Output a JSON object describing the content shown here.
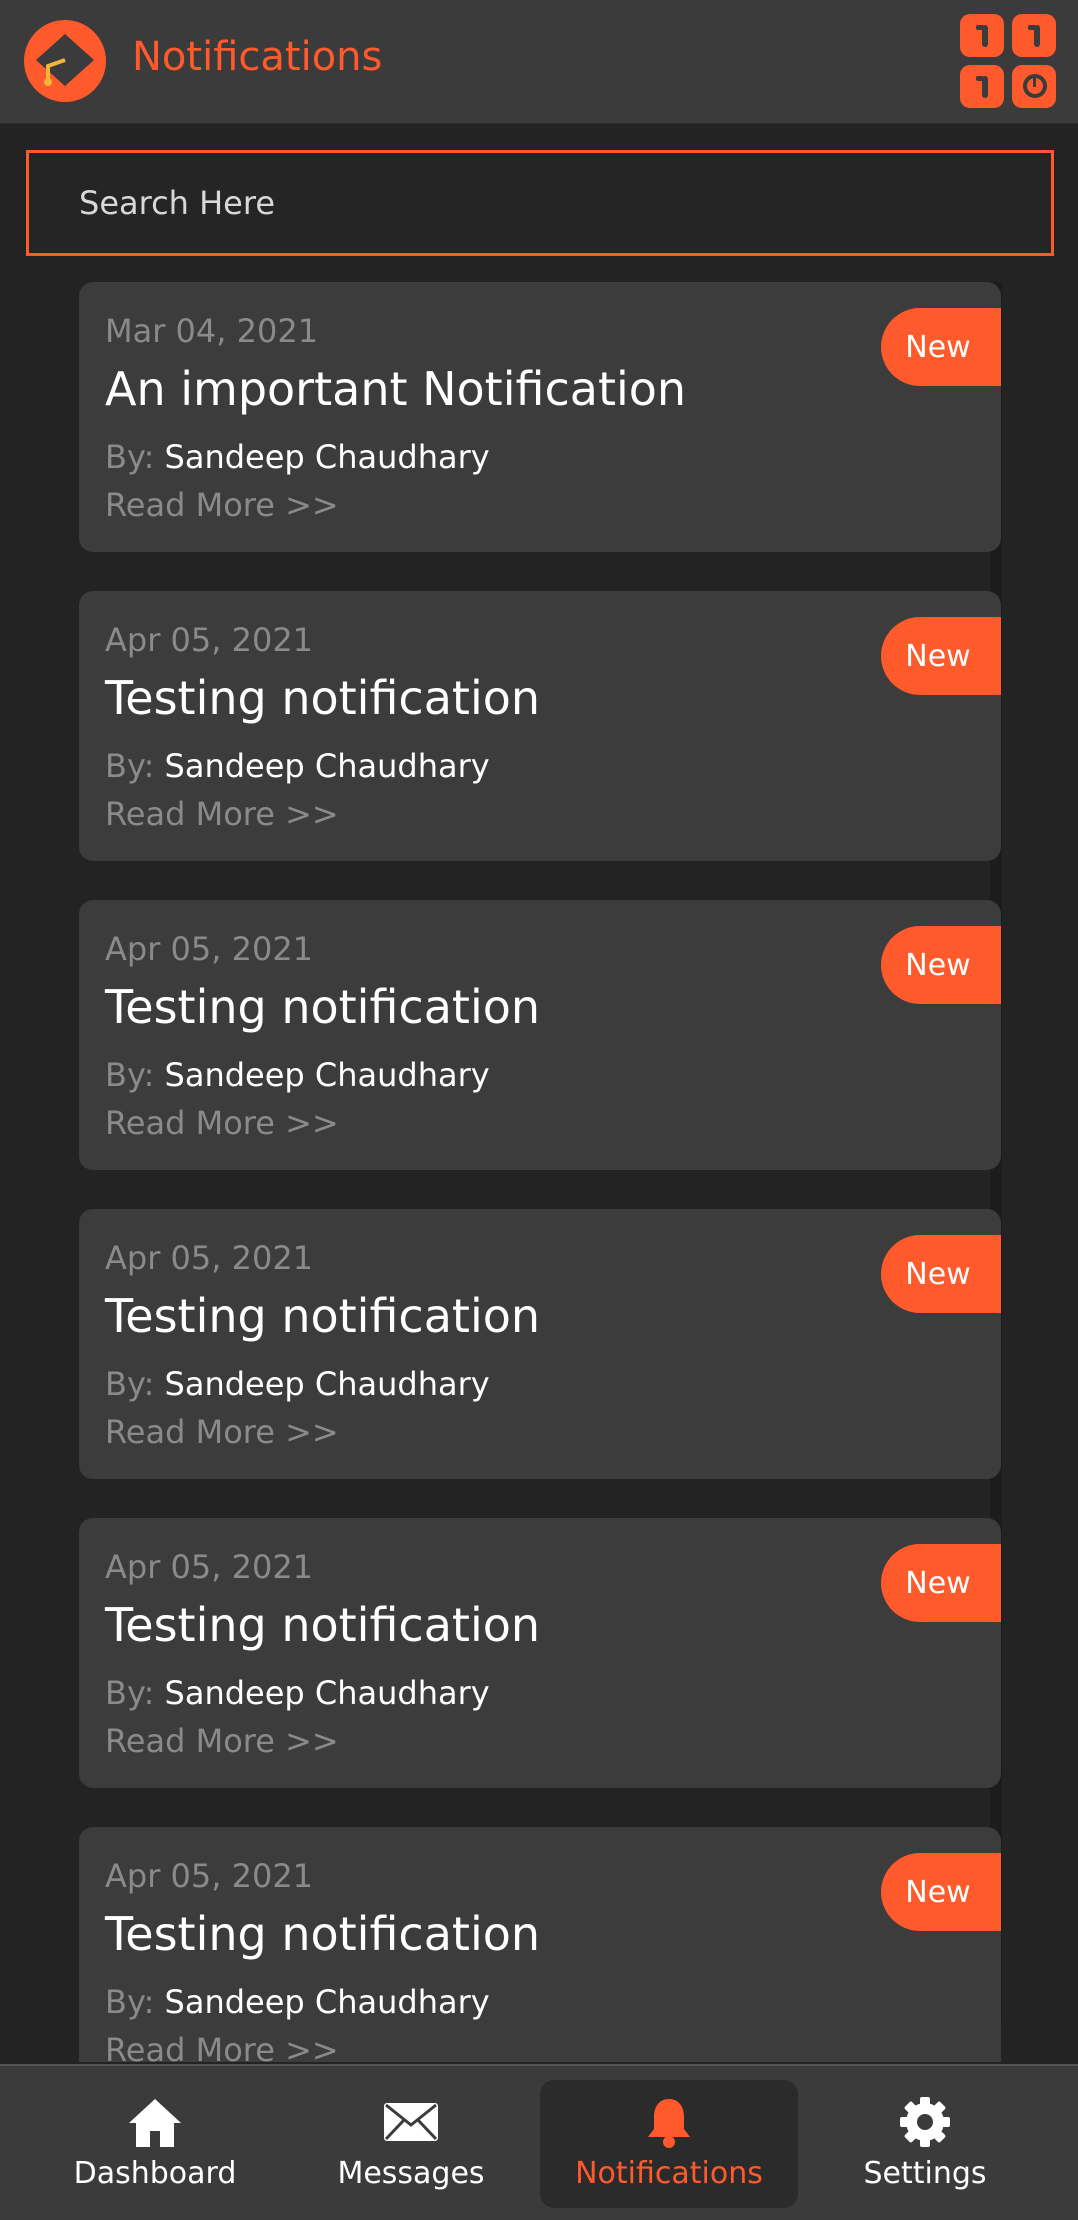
{
  "header": {
    "title": "Notifications",
    "logo_icon": "graduation-cap-icon",
    "menu_icon": "apps-grid-icon"
  },
  "search": {
    "placeholder": "Search Here",
    "value": ""
  },
  "notifications": [
    {
      "date": "Mar 04, 2021",
      "title": "An important Notification",
      "by_label": "By:",
      "author": "Sandeep Chaudhary",
      "read_more": "Read More >>",
      "badge": "New"
    },
    {
      "date": "Apr 05, 2021",
      "title": "Testing notification",
      "by_label": "By:",
      "author": "Sandeep Chaudhary",
      "read_more": "Read More >>",
      "badge": "New"
    },
    {
      "date": "Apr 05, 2021",
      "title": "Testing notification",
      "by_label": "By:",
      "author": "Sandeep Chaudhary",
      "read_more": "Read More >>",
      "badge": "New"
    },
    {
      "date": "Apr 05, 2021",
      "title": "Testing notification",
      "by_label": "By:",
      "author": "Sandeep Chaudhary",
      "read_more": "Read More >>",
      "badge": "New"
    },
    {
      "date": "Apr 05, 2021",
      "title": "Testing notification",
      "by_label": "By:",
      "author": "Sandeep Chaudhary",
      "read_more": "Read More >>",
      "badge": "New"
    },
    {
      "date": "Apr 05, 2021",
      "title": "Testing notification",
      "by_label": "By:",
      "author": "Sandeep Chaudhary",
      "read_more": "Read More >>",
      "badge": "New"
    }
  ],
  "bottom_nav": [
    {
      "label": "Dashboard",
      "icon": "home-icon",
      "active": false
    },
    {
      "label": "Messages",
      "icon": "envelope-icon",
      "active": false
    },
    {
      "label": "Notifications",
      "icon": "bell-icon",
      "active": true
    },
    {
      "label": "Settings",
      "icon": "gear-icon",
      "active": false
    }
  ],
  "colors": {
    "accent": "#ff5a2b",
    "background": "#232323",
    "card": "#3c3c3c",
    "bar": "#3b3b3b"
  }
}
